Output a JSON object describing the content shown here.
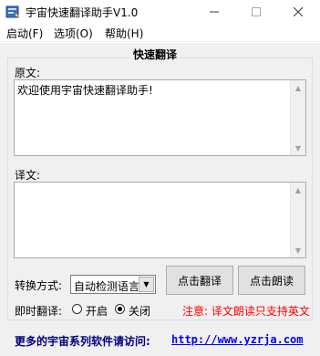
{
  "window": {
    "title": "宇宙快速翻译助手V1.0",
    "icon": "translate-app-icon",
    "controls": {
      "minimize": "─",
      "maximize": "☐",
      "close": "✕"
    }
  },
  "menu": {
    "items": [
      "启动(F)",
      "选项(O)",
      "帮助(H)"
    ]
  },
  "group": {
    "title": "快速翻译"
  },
  "source": {
    "label": "原文:",
    "text": "欢迎使用宇宙快速翻译助手!"
  },
  "target": {
    "label": "译文:",
    "text": ""
  },
  "controls": {
    "mode_label": "转换方式:",
    "mode_selected": "自动检测语言",
    "translate_button": "点击翻译",
    "read_button": "点击朗读",
    "instant_label": "即时翻译:",
    "radio_on": "开启",
    "radio_off": "关闭",
    "instant_state": "关闭"
  },
  "notice": "注意: 译文朗读只支持英文",
  "footer": {
    "label": "更多的宇宙系列软件请访问:",
    "link": "http://www.yzrja.com"
  },
  "colors": {
    "notice": "#ff0000",
    "footer_label": "#000080",
    "link": "#0000ff",
    "client_bg": "#f0f0f0"
  }
}
